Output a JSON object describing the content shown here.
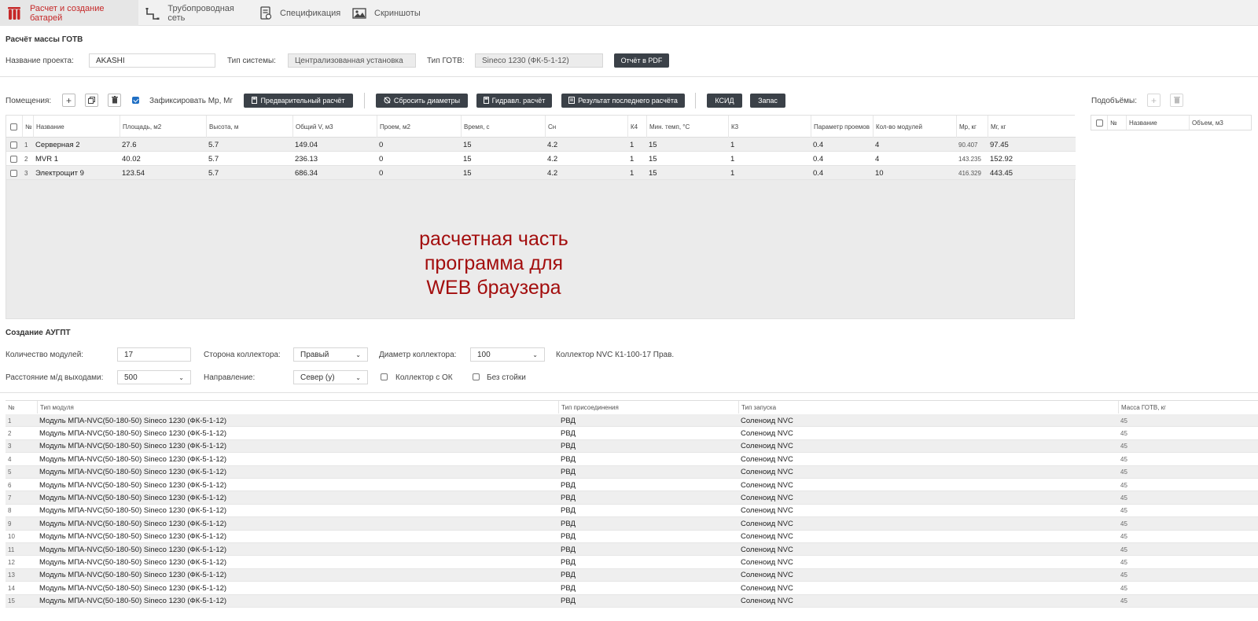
{
  "tabs": [
    {
      "label": "Расчет и создание батарей",
      "icon": "cylinders-icon",
      "active": true
    },
    {
      "label": "Трубопроводная сеть",
      "icon": "pipe-icon",
      "active": false
    },
    {
      "label": "Спецификация",
      "icon": "spec-document-icon",
      "active": false
    },
    {
      "label": "Скриншоты",
      "icon": "image-icon",
      "active": false
    }
  ],
  "mass_calc": {
    "title": "Расчёт массы ГОТВ",
    "project_label": "Название проекта:",
    "project_value": "AKASHI",
    "system_type_label": "Тип системы:",
    "system_type_value": "Централизованная установка",
    "gotv_type_label": "Тип ГОТВ:",
    "gotv_type_value": "Sineco 1230 (ФК-5-1-12)",
    "pdf_button": "Отчёт в PDF"
  },
  "toolbar": {
    "rooms_label": "Помещения:",
    "fix_label": "Зафиксировать Мр, Мг",
    "fix_checked": true,
    "prelim_button": "Предварительный расчёт",
    "reset_button": "Сбросить диаметры",
    "hydraulic_button": "Гидравл. расчёт",
    "last_result_button": "Результат последнего расчёта",
    "ksid_button": "КСИД",
    "reserve_button": "Запас",
    "subvolumes_label": "Подобъёмы:"
  },
  "rooms_table": {
    "headers": [
      "№",
      "Название",
      "Площадь, м2",
      "Высота, м",
      "Общий V, м3",
      "Проем, м2",
      "Время, с",
      "Сн",
      "К4",
      "Мин. темп, °С",
      "К3",
      "Параметр проемов",
      "Кол-во модулей",
      "Мр, кг",
      "Мг, кг"
    ],
    "rows": [
      {
        "n": "1",
        "name": "Серверная 2",
        "area": "27.6",
        "height": "5.7",
        "volume": "149.04",
        "opening": "0",
        "time": "15",
        "cn": "4.2",
        "k4": "1",
        "min_temp": "15",
        "k3": "1",
        "param": "0.4",
        "modules": "4",
        "mr": "90.407",
        "mg": "97.45"
      },
      {
        "n": "2",
        "name": "MVR 1",
        "area": "40.02",
        "height": "5.7",
        "volume": "236.13",
        "opening": "0",
        "time": "15",
        "cn": "4.2",
        "k4": "1",
        "min_temp": "15",
        "k3": "1",
        "param": "0.4",
        "modules": "4",
        "mr": "143.235",
        "mg": "152.92"
      },
      {
        "n": "3",
        "name": "Электрощит 9",
        "area": "123.54",
        "height": "5.7",
        "volume": "686.34",
        "opening": "0",
        "time": "15",
        "cn": "4.2",
        "k4": "1",
        "min_temp": "15",
        "k3": "1",
        "param": "0.4",
        "modules": "10",
        "mr": "416.329",
        "mg": "443.45"
      }
    ]
  },
  "overlay_text": {
    "line1": "расчетная часть",
    "line2": "программа для",
    "line3": "WEB браузера"
  },
  "subvolumes_table": {
    "headers": [
      "№",
      "Название",
      "Объем, м3"
    ]
  },
  "augpt": {
    "title": "Создание АУГПТ",
    "modules_count_label": "Количество модулей:",
    "modules_count_value": "17",
    "collector_side_label": "Сторона коллектора:",
    "collector_side_value": "Правый",
    "collector_diameter_label": "Диаметр коллектора:",
    "collector_diameter_value": "100",
    "collector_name": "Коллектор NVC К1-100-17 Прав.",
    "distance_label": "Расстояние м/д выходами:",
    "distance_value": "500",
    "direction_label": "Направление:",
    "direction_value": "Север (y)",
    "collector_ok_label": "Коллектор с ОК",
    "no_rack_label": "Без стойки"
  },
  "modules_table": {
    "headers": [
      "№",
      "Тип модуля",
      "Тип присоединения",
      "Тип запуска",
      "Масса ГОТВ, кг"
    ],
    "rows": [
      [
        "1",
        "Модуль МПА-NVC(50-180-50) Sineco 1230 (ФК-5-1-12)",
        "РВД",
        "Соленоид NVC",
        "45"
      ],
      [
        "2",
        "Модуль МПА-NVC(50-180-50) Sineco 1230 (ФК-5-1-12)",
        "РВД",
        "Соленоид NVC",
        "45"
      ],
      [
        "3",
        "Модуль МПА-NVC(50-180-50) Sineco 1230 (ФК-5-1-12)",
        "РВД",
        "Соленоид NVC",
        "45"
      ],
      [
        "4",
        "Модуль МПА-NVC(50-180-50) Sineco 1230 (ФК-5-1-12)",
        "РВД",
        "Соленоид NVC",
        "45"
      ],
      [
        "5",
        "Модуль МПА-NVC(50-180-50) Sineco 1230 (ФК-5-1-12)",
        "РВД",
        "Соленоид NVC",
        "45"
      ],
      [
        "6",
        "Модуль МПА-NVC(50-180-50) Sineco 1230 (ФК-5-1-12)",
        "РВД",
        "Соленоид NVC",
        "45"
      ],
      [
        "7",
        "Модуль МПА-NVC(50-180-50) Sineco 1230 (ФК-5-1-12)",
        "РВД",
        "Соленоид NVC",
        "45"
      ],
      [
        "8",
        "Модуль МПА-NVC(50-180-50) Sineco 1230 (ФК-5-1-12)",
        "РВД",
        "Соленоид NVC",
        "45"
      ],
      [
        "9",
        "Модуль МПА-NVC(50-180-50) Sineco 1230 (ФК-5-1-12)",
        "РВД",
        "Соленоид NVC",
        "45"
      ],
      [
        "10",
        "Модуль МПА-NVC(50-180-50) Sineco 1230 (ФК-5-1-12)",
        "РВД",
        "Соленоид NVC",
        "45"
      ],
      [
        "11",
        "Модуль МПА-NVC(50-180-50) Sineco 1230 (ФК-5-1-12)",
        "РВД",
        "Соленоид NVC",
        "45"
      ],
      [
        "12",
        "Модуль МПА-NVC(50-180-50) Sineco 1230 (ФК-5-1-12)",
        "РВД",
        "Соленоид NVC",
        "45"
      ],
      [
        "13",
        "Модуль МПА-NVC(50-180-50) Sineco 1230 (ФК-5-1-12)",
        "РВД",
        "Соленоид NVC",
        "45"
      ],
      [
        "14",
        "Модуль МПА-NVC(50-180-50) Sineco 1230 (ФК-5-1-12)",
        "РВД",
        "Соленоид NVC",
        "45"
      ],
      [
        "15",
        "Модуль МПА-NVC(50-180-50) Sineco 1230 (ФК-5-1-12)",
        "РВД",
        "Соленоид NVC",
        "45"
      ]
    ]
  },
  "colors": {
    "accent_red": "#c62828",
    "overlay_red": "#a30d0d",
    "dark_button": "#3b4148",
    "checkbox_blue": "#1f6fc4"
  }
}
